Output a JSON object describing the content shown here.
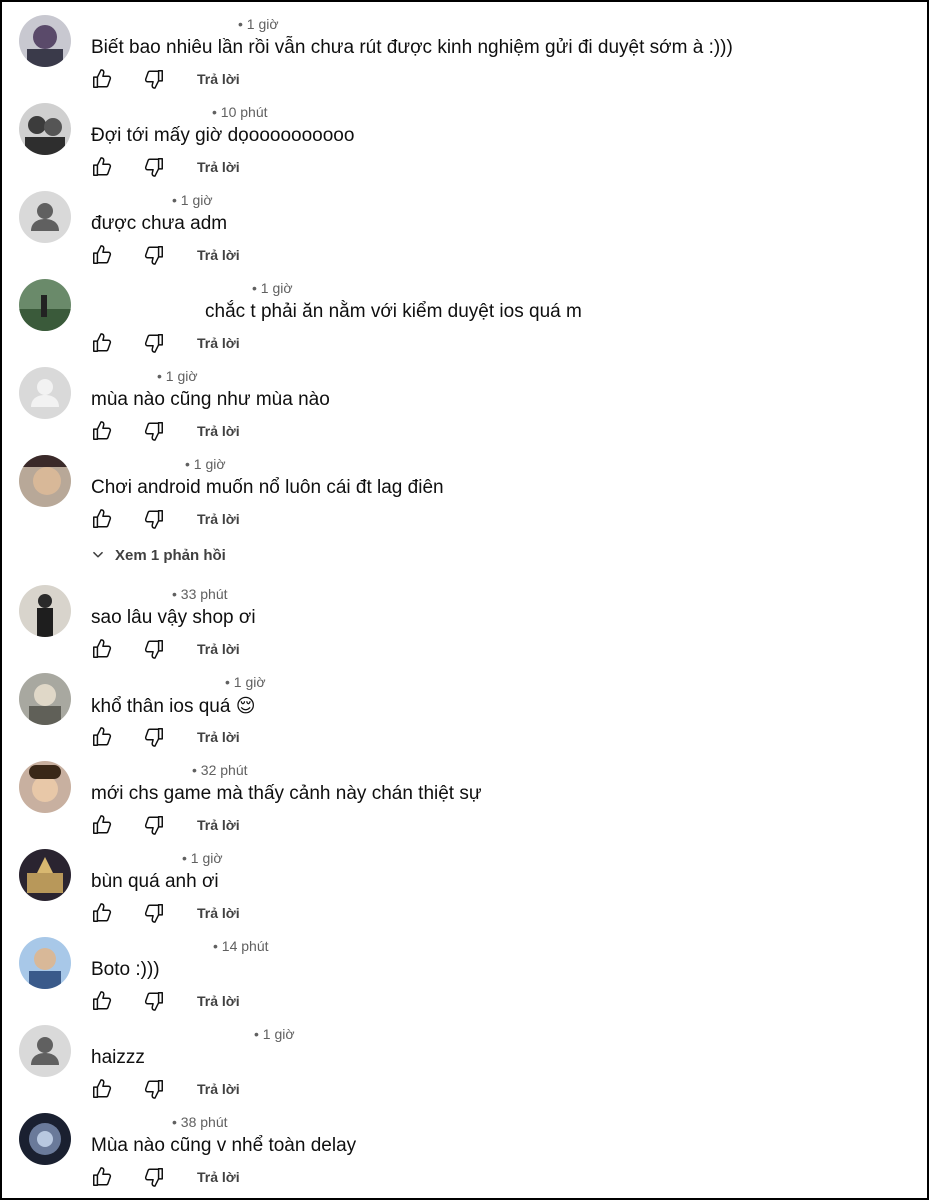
{
  "reply_label": "Trả lời",
  "view_replies_label": "Xem 1 phản hồi",
  "comments": [
    {
      "time": "• 1 giờ",
      "text": "Biết bao nhiêu lần rồi vẫn chưa rút được kinh nghiệm gửi đi duyệt sớm à :)))",
      "avatar": "photo"
    },
    {
      "time": "• 10 phút",
      "text": "Đợi tới mấy giờ dọoooooooooo",
      "avatar": "photo"
    },
    {
      "time": "• 1 giờ",
      "text": "được chưa adm",
      "avatar": "default"
    },
    {
      "time": "• 1 giờ",
      "text": "chắc t phải ăn nằm với kiểm duyệt ios quá m",
      "avatar": "photo"
    },
    {
      "time": "• 1 giờ",
      "text": "mùa nào cũng như mùa nào",
      "avatar": "default"
    },
    {
      "time": "• 1 giờ",
      "text": "Chơi android muốn nổ luôn cái đt lag điên",
      "avatar": "photo"
    },
    {
      "time": "• 33 phút",
      "text": "sao lâu vậy shop ơi",
      "avatar": "photo"
    },
    {
      "time": "• 1 giờ",
      "text": "khổ thân ios quá 😌",
      "avatar": "photo"
    },
    {
      "time": "• 32 phút",
      "text": "mới chs game mà thấy cảnh này chán thiệt sự",
      "avatar": "photo"
    },
    {
      "time": "• 1 giờ",
      "text": "bùn quá anh ơi",
      "avatar": "photo"
    },
    {
      "time": "• 14 phút",
      "text": "Boto :)))",
      "avatar": "photo"
    },
    {
      "time": "• 1 giờ",
      "text": "haizzz",
      "avatar": "default"
    },
    {
      "time": "• 38 phút",
      "text": "Mùa nào cũng v nhể toàn delay",
      "avatar": "photo"
    }
  ],
  "colors": {
    "text": "#0f0f0f",
    "meta": "#606060",
    "action": "#404040",
    "placeholder_avatar": "#d9d9d9"
  },
  "icons": [
    "thumb-up-icon",
    "thumb-down-icon",
    "chevron-down-icon",
    "default-avatar-icon"
  ]
}
